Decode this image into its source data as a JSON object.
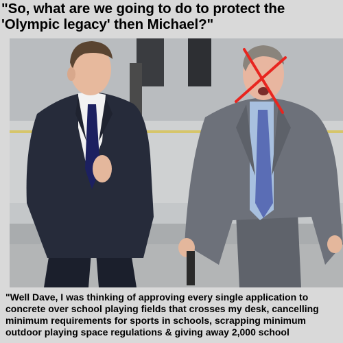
{
  "headline": {
    "line1": "\"So, what are we going to do to protect the",
    "line2": "'Olympic legacy' then Michael?\""
  },
  "caption": {
    "lines": [
      "\"Well Dave, I was thinking of approving every single application to",
      "concrete over school playing fields that crosses my desk, cancelling",
      "minimum requirements for sports in schools, scrapping minimum",
      "outdoor playing space regulations & giving away 2,000 school"
    ]
  },
  "colors": {
    "background": "#d9d9d9",
    "cross": "#e8251f",
    "suit_left": "#262b3a",
    "suit_right": "#6d717a"
  }
}
